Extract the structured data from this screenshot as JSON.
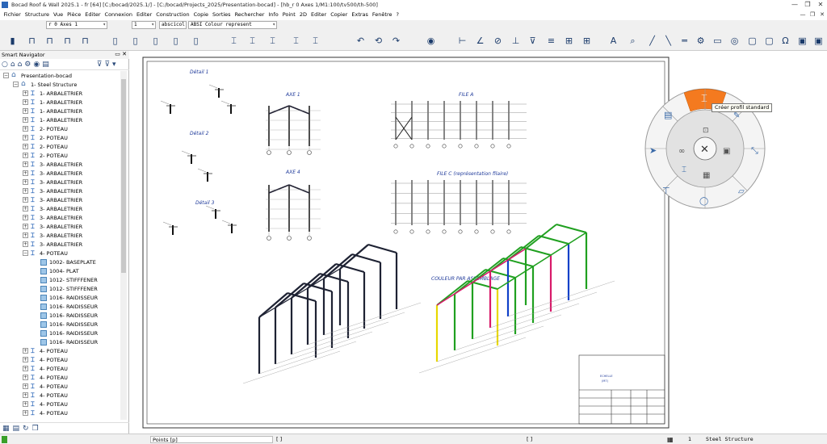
{
  "window": {
    "title": "Bocad Roof & Wall 2025.1 - fr [64]  [C:/bocad/2025.1/]   -  [C:/bocad/Projects_2025/Presentation-bocad] - [hb_r 0 Axes 1/M1:100/tv500/th-500]",
    "controls": [
      "—",
      "❐",
      "✕"
    ]
  },
  "menu": [
    "Fichier",
    "Structure",
    "Vue",
    "Pièce",
    "Editer",
    "Connexion",
    "Editer",
    "Construction",
    "Copie",
    "Sorties",
    "Rechercher",
    "Info",
    "Point",
    "2D",
    "Editer",
    "Copier",
    "Extras",
    "Fenêtre",
    "?"
  ],
  "mdi_controls": [
    "—",
    "❐",
    "✕"
  ],
  "combos": {
    "view": "r 0 Axes 1",
    "count": "1",
    "layer": "abscicol",
    "color": "ABSI Colour represent"
  },
  "navigator": {
    "title": "Smart Navigator",
    "tree": [
      {
        "label": "Presentation-bocad",
        "level": 0,
        "icon": "building",
        "exp": "−"
      },
      {
        "label": "1- Steel Structure",
        "level": 1,
        "icon": "building",
        "exp": "−"
      },
      {
        "label": "1- ARBALETRIER",
        "level": 2,
        "icon": "beam",
        "exp": "+"
      },
      {
        "label": "1- ARBALETRIER",
        "level": 2,
        "icon": "beam",
        "exp": "+"
      },
      {
        "label": "1- ARBALETRIER",
        "level": 2,
        "icon": "beam",
        "exp": "+"
      },
      {
        "label": "1- ARBALETRIER",
        "level": 2,
        "icon": "beam",
        "exp": "+"
      },
      {
        "label": "2- POTEAU",
        "level": 2,
        "icon": "beam",
        "exp": "+"
      },
      {
        "label": "2- POTEAU",
        "level": 2,
        "icon": "beam",
        "exp": "+"
      },
      {
        "label": "2- POTEAU",
        "level": 2,
        "icon": "beam",
        "exp": "+"
      },
      {
        "label": "2- POTEAU",
        "level": 2,
        "icon": "beam",
        "exp": "+"
      },
      {
        "label": "3- ARBALETRIER",
        "level": 2,
        "icon": "beam",
        "exp": "+"
      },
      {
        "label": "3- ARBALETRIER",
        "level": 2,
        "icon": "beam",
        "exp": "+"
      },
      {
        "label": "3- ARBALETRIER",
        "level": 2,
        "icon": "beam",
        "exp": "+"
      },
      {
        "label": "3- ARBALETRIER",
        "level": 2,
        "icon": "beam",
        "exp": "+"
      },
      {
        "label": "3- ARBALETRIER",
        "level": 2,
        "icon": "beam",
        "exp": "+"
      },
      {
        "label": "3- ARBALETRIER",
        "level": 2,
        "icon": "beam",
        "exp": "+"
      },
      {
        "label": "3- ARBALETRIER",
        "level": 2,
        "icon": "beam",
        "exp": "+"
      },
      {
        "label": "3- ARBALETRIER",
        "level": 2,
        "icon": "beam",
        "exp": "+"
      },
      {
        "label": "3- ARBALETRIER",
        "level": 2,
        "icon": "beam",
        "exp": "+"
      },
      {
        "label": "3- ARBALETRIER",
        "level": 2,
        "icon": "beam",
        "exp": "+"
      },
      {
        "label": "4- POTEAU",
        "level": 2,
        "icon": "beam",
        "exp": "−"
      },
      {
        "label": "1002- BASEPLATE",
        "level": 3,
        "icon": "plate",
        "exp": ""
      },
      {
        "label": "1004- PLAT",
        "level": 3,
        "icon": "plate",
        "exp": ""
      },
      {
        "label": "1012- STIFFFENER",
        "level": 3,
        "icon": "plate",
        "exp": ""
      },
      {
        "label": "1012- STIFFFENER",
        "level": 3,
        "icon": "plate",
        "exp": ""
      },
      {
        "label": "1016- RAIDISSEUR",
        "level": 3,
        "icon": "plate",
        "exp": ""
      },
      {
        "label": "1016- RAIDISSEUR",
        "level": 3,
        "icon": "plate",
        "exp": ""
      },
      {
        "label": "1016- RAIDISSEUR",
        "level": 3,
        "icon": "plate",
        "exp": ""
      },
      {
        "label": "1016- RAIDISSEUR",
        "level": 3,
        "icon": "plate",
        "exp": ""
      },
      {
        "label": "1016- RAIDISSEUR",
        "level": 3,
        "icon": "plate",
        "exp": ""
      },
      {
        "label": "1016- RAIDISSEUR",
        "level": 3,
        "icon": "plate",
        "exp": ""
      },
      {
        "label": "4- POTEAU",
        "level": 2,
        "icon": "beam",
        "exp": "+"
      },
      {
        "label": "4- POTEAU",
        "level": 2,
        "icon": "beam",
        "exp": "+"
      },
      {
        "label": "4- POTEAU",
        "level": 2,
        "icon": "beam",
        "exp": "+"
      },
      {
        "label": "4- POTEAU",
        "level": 2,
        "icon": "beam",
        "exp": "+"
      },
      {
        "label": "4- POTEAU",
        "level": 2,
        "icon": "beam",
        "exp": "+"
      },
      {
        "label": "4- POTEAU",
        "level": 2,
        "icon": "beam",
        "exp": "+"
      },
      {
        "label": "4- POTEAU",
        "level": 2,
        "icon": "beam",
        "exp": "+"
      },
      {
        "label": "4- POTEAU",
        "level": 2,
        "icon": "beam",
        "exp": "+"
      }
    ]
  },
  "drawing": {
    "labels": {
      "detail1": "Détail 1",
      "detail2": "Détail 2",
      "detail3": "Détail 3",
      "axe1": "AXE 1",
      "axe4": "AXE 4",
      "fileA": "FILE A",
      "fileC": "FILE C (représentation filaire)",
      "couleur": "COULEUR PAR ASSEMBLAGE"
    }
  },
  "radial_menu": {
    "tooltip": "Créer profil standard",
    "center_symbol": "✕"
  },
  "colors": {
    "accent_orange": "#f47a1f",
    "tree_icon_blue": "#2b66b8",
    "drawing_label": "#1f3a9a",
    "status_green": "#3aa02a"
  },
  "status": {
    "mode": "Points [p]",
    "bracket1": "[ ]",
    "bracket2": "[ ]",
    "layer": "1",
    "structure": "Steel Structure"
  }
}
